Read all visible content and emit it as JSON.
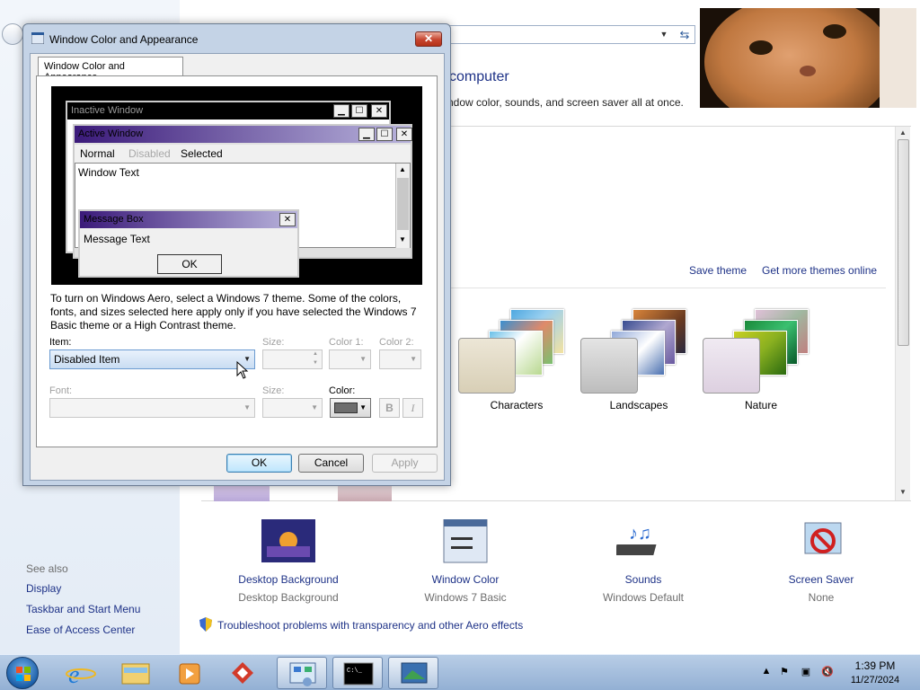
{
  "control_panel": {
    "heading": "computer",
    "subtitle": "ndow color, sounds, and screen saver all at once.",
    "links": {
      "save_theme": "Save theme",
      "get_more": "Get more themes online"
    },
    "themes": [
      {
        "label": "Characters"
      },
      {
        "label": "Landscapes"
      },
      {
        "label": "Nature"
      }
    ],
    "see_also": {
      "title": "See also",
      "items": [
        "Display",
        "Taskbar and Start Menu",
        "Ease of Access Center"
      ]
    },
    "shortcuts": [
      {
        "title": "Desktop Background",
        "value": "Desktop Background",
        "icon": "desktop-background-icon"
      },
      {
        "title": "Window Color",
        "value": "Windows 7 Basic",
        "icon": "window-color-icon"
      },
      {
        "title": "Sounds",
        "value": "Windows Default",
        "icon": "sounds-icon"
      },
      {
        "title": "Screen Saver",
        "value": "None",
        "icon": "screen-saver-icon"
      }
    ],
    "troubleshoot": "Troubleshoot problems with transparency and other Aero effects"
  },
  "dialog": {
    "title": "Window Color and Appearance",
    "close": "✕",
    "tab": "Window Color and Appearance",
    "preview": {
      "inactive_title": "Inactive Window",
      "active_title": "Active Window",
      "menu": {
        "normal": "Normal",
        "disabled": "Disabled",
        "selected": "Selected"
      },
      "window_text": "Window Text",
      "msgbox_title": "Message Box",
      "msgbox_text": "Message Text",
      "msgbox_ok": "OK",
      "caption_buttons": {
        "minimize": "▁",
        "maximize": "☐",
        "close": "✕"
      }
    },
    "info": "To turn on Windows Aero, select a Windows 7 theme.  Some of the colors, fonts, and sizes selected here apply only if you have selected the Windows 7 Basic theme or a High Contrast theme.",
    "form": {
      "item_label": "Item:",
      "item_value": "Disabled Item",
      "size_label": "Size:",
      "color1_label": "Color 1:",
      "color2_label": "Color 2:",
      "font_label": "Font:",
      "size2_label": "Size:",
      "color_label": "Color:",
      "color_value": "#6d6d6d",
      "bold": "B",
      "italic": "I"
    },
    "buttons": {
      "ok": "OK",
      "cancel": "Cancel",
      "apply": "Apply"
    }
  },
  "taskbar": {
    "time": "1:39 PM",
    "date": "11/27/2024",
    "items": [
      "internet-explorer-icon",
      "windows-explorer-icon",
      "media-player-icon",
      "gmail-icon",
      "control-panel-icon",
      "command-prompt-icon",
      "display-settings-icon"
    ]
  },
  "colors": {
    "link": "#1e3287",
    "active_title_start": "#3b1a7a",
    "active_title_end": "#b9b4dc"
  }
}
